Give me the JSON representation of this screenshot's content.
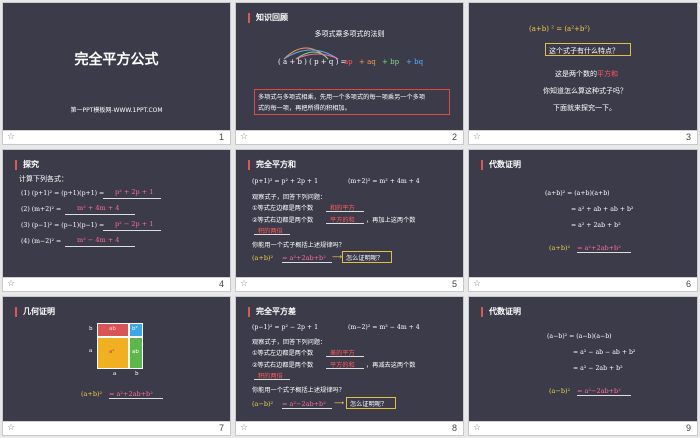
{
  "slides": [
    {
      "number": "1",
      "title": "完全平方公式",
      "subtitle": "第一PPT模板网-WWW.1PPT.COM"
    },
    {
      "number": "2",
      "section": "知识回顾",
      "heading": "多项式乘多项式的法则",
      "formula_lhs": "( a + b ) ( p + q ) =",
      "terms": [
        "ap",
        "+ aq",
        "+ bp",
        "+ bq"
      ],
      "rule_line1": "多项式与多项式相乘，先用一个多项式的每一项乘另一个多项",
      "rule_line2": "式的每一项，再把所得的积相加。"
    },
    {
      "number": "3",
      "expr": "(a+b) ² = (a²+b²)",
      "question": "这个式子有什么特点？",
      "line1": "这是两个数的",
      "line1_hl": "平方和",
      "line2": "你知道怎么算这种式子吗？",
      "line3": "下面就来探究一下。"
    },
    {
      "number": "4",
      "section": "探究",
      "intro": "计算下列各式：",
      "items": [
        {
          "lhs": "(1) (p+1)² = (p+1)(p+1) =",
          "ans": "p² + 2p + 1"
        },
        {
          "lhs": "(2) (m+2)² =",
          "ans": "m² + 4m + 4"
        },
        {
          "lhs": "(3) (p−1)² = (p−1)(p−1) =",
          "ans": "p² − 2p + 1"
        },
        {
          "lhs": "(4) (m−2)² =",
          "ans": "m² − 4m + 4"
        }
      ]
    },
    {
      "number": "5",
      "section": "完全平方和",
      "eq1": "(p+1)² = p² + 2p + 1",
      "eq2": "(m+2)² = m² + 4m + 4",
      "observe": "观察式子，回答下列问题：",
      "q1": "①等式左边都是两个数",
      "q1_ans": "和的平方",
      "q2": "②等式右边都是两个数",
      "q2_ans": "平方的和",
      "q2_tail": "，再加上这两个数",
      "q2_ans2": "积的两倍",
      "ask": "你能用一个式子概括上述规律吗？",
      "result_lhs": "(a+b)²",
      "result_rhs": "= a²+2ab+b²",
      "prove": "怎么证明呢？"
    },
    {
      "number": "6",
      "section": "代数证明",
      "lines": [
        "(a+b)² = (a+b)(a+b)",
        "= a² + ab + ab + b²",
        "= a² + 2ab + b²"
      ],
      "result_lhs": "(a+b)²",
      "result_rhs": "= a²+2ab+b²"
    },
    {
      "number": "7",
      "section": "几何证明",
      "cells": [
        "ab",
        "b²",
        "a²",
        "ab"
      ],
      "labels": [
        "b",
        "a",
        "a",
        "b"
      ],
      "result_lhs": "(a+b)²",
      "result_rhs": "= a²+2ab+b²"
    },
    {
      "number": "8",
      "section": "完全平方差",
      "eq1": "(p−1)² = p² − 2p + 1",
      "eq2": "(m−2)² = m² − 4m + 4",
      "observe": "观察式子，回答下列问题：",
      "q1": "①等式左边都是两个数",
      "q1_ans": "差的平方",
      "q2": "②等式右边都是两个数",
      "q2_ans": "平方的和",
      "q2_tail": "，再减去这两个数",
      "q2_ans2": "积的两倍",
      "ask": "你能用一个式子概括上述规律吗？",
      "result_lhs": "(a−b)²",
      "result_rhs": "= a²−2ab+b²",
      "prove": "怎么证明呢？"
    },
    {
      "number": "9",
      "section": "代数证明",
      "lines": [
        "(a−b)² = (a−b)(a−b)",
        "= a² − ab − ab + b²",
        "= a² − 2ab + b²"
      ],
      "result_lhs": "(a−b)²",
      "result_rhs": "= a²−2ab+b²"
    }
  ]
}
